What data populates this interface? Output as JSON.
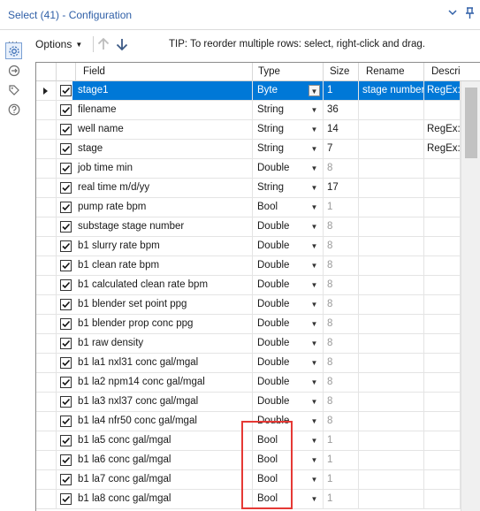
{
  "window": {
    "title": "Select (41) - Configuration",
    "icons": [
      "chevron-down-icon",
      "pin-icon"
    ]
  },
  "sidebar": {
    "icons": [
      "more-dots-icon",
      "gear-icon",
      "connection-icon",
      "tag-icon",
      "help-icon"
    ],
    "dots": "···"
  },
  "toolbar": {
    "options_label": "Options",
    "tip": "TIP: To reorder multiple rows: select, right-click and drag."
  },
  "grid": {
    "columns": [
      "Field",
      "Type",
      "Size",
      "Rename",
      "Descri"
    ],
    "rows": [
      {
        "checked": true,
        "field": "stage1",
        "type": "Byte",
        "size": "1",
        "rename": "stage number",
        "description": "RegEx:",
        "selected": true
      },
      {
        "checked": true,
        "field": "filename",
        "type": "String",
        "size": "36",
        "rename": "",
        "description": ""
      },
      {
        "checked": true,
        "field": "well name",
        "type": "String",
        "size": "14",
        "rename": "",
        "description": "RegEx:"
      },
      {
        "checked": true,
        "field": "stage",
        "type": "String",
        "size": "7",
        "rename": "",
        "description": "RegEx:"
      },
      {
        "checked": true,
        "field": "job time min",
        "type": "Double",
        "size": "8",
        "rename": "",
        "description": ""
      },
      {
        "checked": true,
        "field": "real time m/d/yy",
        "type": "String",
        "size": "17",
        "rename": "",
        "description": ""
      },
      {
        "checked": true,
        "field": "pump rate bpm",
        "type": "Bool",
        "size": "1",
        "rename": "",
        "description": ""
      },
      {
        "checked": true,
        "field": "substage stage number",
        "type": "Double",
        "size": "8",
        "rename": "",
        "description": ""
      },
      {
        "checked": true,
        "field": "b1 slurry rate bpm",
        "type": "Double",
        "size": "8",
        "rename": "",
        "description": ""
      },
      {
        "checked": true,
        "field": "b1 clean rate bpm",
        "type": "Double",
        "size": "8",
        "rename": "",
        "description": ""
      },
      {
        "checked": true,
        "field": "b1 calculated clean rate bpm",
        "type": "Double",
        "size": "8",
        "rename": "",
        "description": ""
      },
      {
        "checked": true,
        "field": "b1 blender set point ppg",
        "type": "Double",
        "size": "8",
        "rename": "",
        "description": ""
      },
      {
        "checked": true,
        "field": "b1 blender prop conc ppg",
        "type": "Double",
        "size": "8",
        "rename": "",
        "description": ""
      },
      {
        "checked": true,
        "field": "b1 raw density",
        "type": "Double",
        "size": "8",
        "rename": "",
        "description": ""
      },
      {
        "checked": true,
        "field": "b1  la1  nxl31 conc gal/mgal",
        "type": "Double",
        "size": "8",
        "rename": "",
        "description": ""
      },
      {
        "checked": true,
        "field": "b1  la2  npm14 conc gal/mgal",
        "type": "Double",
        "size": "8",
        "rename": "",
        "description": ""
      },
      {
        "checked": true,
        "field": "b1  la3  nxl37 conc gal/mgal",
        "type": "Double",
        "size": "8",
        "rename": "",
        "description": ""
      },
      {
        "checked": true,
        "field": "b1  la4  nfr50 conc gal/mgal",
        "type": "Double",
        "size": "8",
        "rename": "",
        "description": ""
      },
      {
        "checked": true,
        "field": "b1  la5  conc gal/mgal",
        "type": "Bool",
        "size": "1",
        "rename": "",
        "description": ""
      },
      {
        "checked": true,
        "field": "b1  la6  conc gal/mgal",
        "type": "Bool",
        "size": "1",
        "rename": "",
        "description": ""
      },
      {
        "checked": true,
        "field": "b1  la7  conc gal/mgal",
        "type": "Bool",
        "size": "1",
        "rename": "",
        "description": ""
      },
      {
        "checked": true,
        "field": "b1  la8  conc gal/mgal",
        "type": "Bool",
        "size": "1",
        "rename": "",
        "description": ""
      }
    ]
  },
  "colors": {
    "accent": "#2f5fa7",
    "selection": "#0078d7",
    "annotation": "#e53935"
  }
}
